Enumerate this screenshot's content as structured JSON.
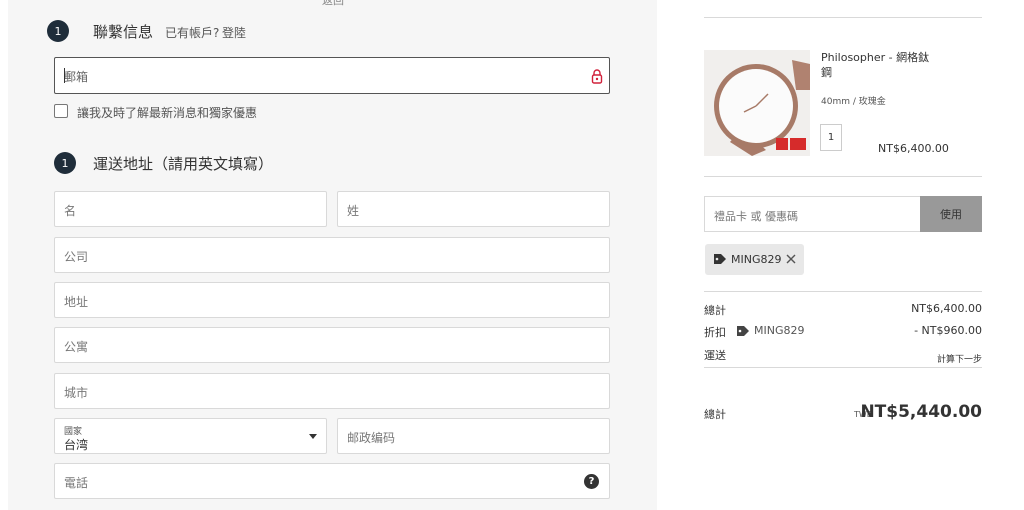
{
  "top_cut_text": "返回",
  "contact": {
    "step": "1",
    "title": "聯繫信息",
    "have_account": "已有帳戶?",
    "login": "登陸",
    "email_placeholder": "郵箱",
    "newsletter_label": "讓我及時了解最新消息和獨家優惠"
  },
  "shipping": {
    "step": "1",
    "title": "運送地址（請用英文填寫）",
    "first_name": "名",
    "last_name": "姓",
    "company": "公司",
    "address": "地址",
    "apartment": "公寓",
    "city": "城市",
    "country_label": "國家",
    "country_value": "台湾",
    "postal_code": "邮政编码",
    "phone": "電話"
  },
  "product": {
    "name": "Philosopher - 網格鈦鋼",
    "variant": "40mm / 玫瑰金",
    "quantity": "1",
    "price": "NT$6,400.00"
  },
  "gift": {
    "placeholder": "禮品卡 或 優惠碼",
    "apply_label": "使用"
  },
  "coupon_code": "MING829",
  "summary": {
    "subtotal_label": "總計",
    "subtotal_value": "NT$6,400.00",
    "discount_label": "折扣",
    "discount_code": "MING829",
    "discount_value": "- NT$960.00",
    "shipping_label": "運送",
    "shipping_value": "計算下一步",
    "total_label": "總計",
    "total_currency": "TWD",
    "total_value": "NT$5,440.00"
  },
  "colors": {
    "badge": "#1f2d3a",
    "apply_button": "#999999",
    "lock_icon": "#d0203a",
    "panel_bg": "#f6f6f6"
  }
}
